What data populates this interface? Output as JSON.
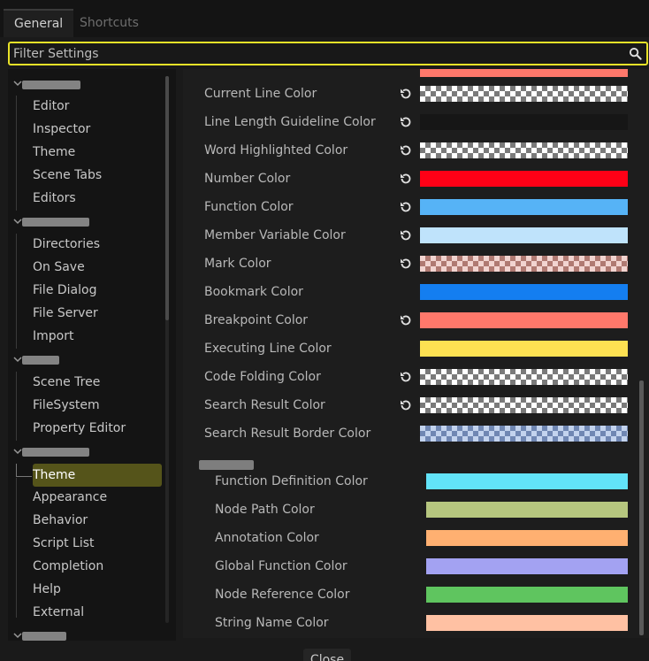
{
  "tabs": [
    {
      "label": "General",
      "active": true
    },
    {
      "label": "Shortcuts",
      "active": false
    }
  ],
  "filter": {
    "placeholder": "Filter Settings"
  },
  "tree": {
    "group1_items": [
      "Editor",
      "Inspector",
      "Theme",
      "Scene Tabs",
      "Editors"
    ],
    "group2_items": [
      "Directories",
      "On Save",
      "File Dialog",
      "File Server",
      "Import"
    ],
    "group3_items": [
      "Scene Tree",
      "FileSystem",
      "Property Editor"
    ],
    "group4_items": [
      "Theme",
      "Appearance",
      "Behavior",
      "Script List",
      "Completion",
      "Help",
      "External"
    ],
    "selected": "Theme"
  },
  "properties": [
    {
      "label": "Current Line Color",
      "color": "checker",
      "revert": true
    },
    {
      "label": "Line Length Guideline Color",
      "color": "#161616",
      "revert": true
    },
    {
      "label": "Word Highlighted Color",
      "color": "checker",
      "revert": true
    },
    {
      "label": "Number Color",
      "color": "#ff0016",
      "revert": true
    },
    {
      "label": "Function Color",
      "color": "#56b3f6",
      "revert": true
    },
    {
      "label": "Member Variable Color",
      "color": "#bfe3fb",
      "revert": true
    },
    {
      "label": "Mark Color",
      "color": "checker-red",
      "revert": true
    },
    {
      "label": "Bookmark Color",
      "color": "#147ef0",
      "revert": false
    },
    {
      "label": "Breakpoint Color",
      "color": "#ff786b",
      "revert": true
    },
    {
      "label": "Executing Line Color",
      "color": "#fde152",
      "revert": false
    },
    {
      "label": "Code Folding Color",
      "color": "checker",
      "revert": true
    },
    {
      "label": "Search Result Color",
      "color": "checker",
      "revert": true
    },
    {
      "label": "Search Result Border Color",
      "color": "checker-blue",
      "revert": false
    }
  ],
  "sub_properties": [
    {
      "label": "Function Definition Color",
      "color": "#62e3f8"
    },
    {
      "label": "Node Path Color",
      "color": "#b6c67f"
    },
    {
      "label": "Annotation Color",
      "color": "#ffb071"
    },
    {
      "label": "Global Function Color",
      "color": "#a3a2f2"
    },
    {
      "label": "Node Reference Color",
      "color": "#5fc55f"
    },
    {
      "label": "String Name Color",
      "color": "#ffc1a3"
    }
  ],
  "close_label": "Close"
}
